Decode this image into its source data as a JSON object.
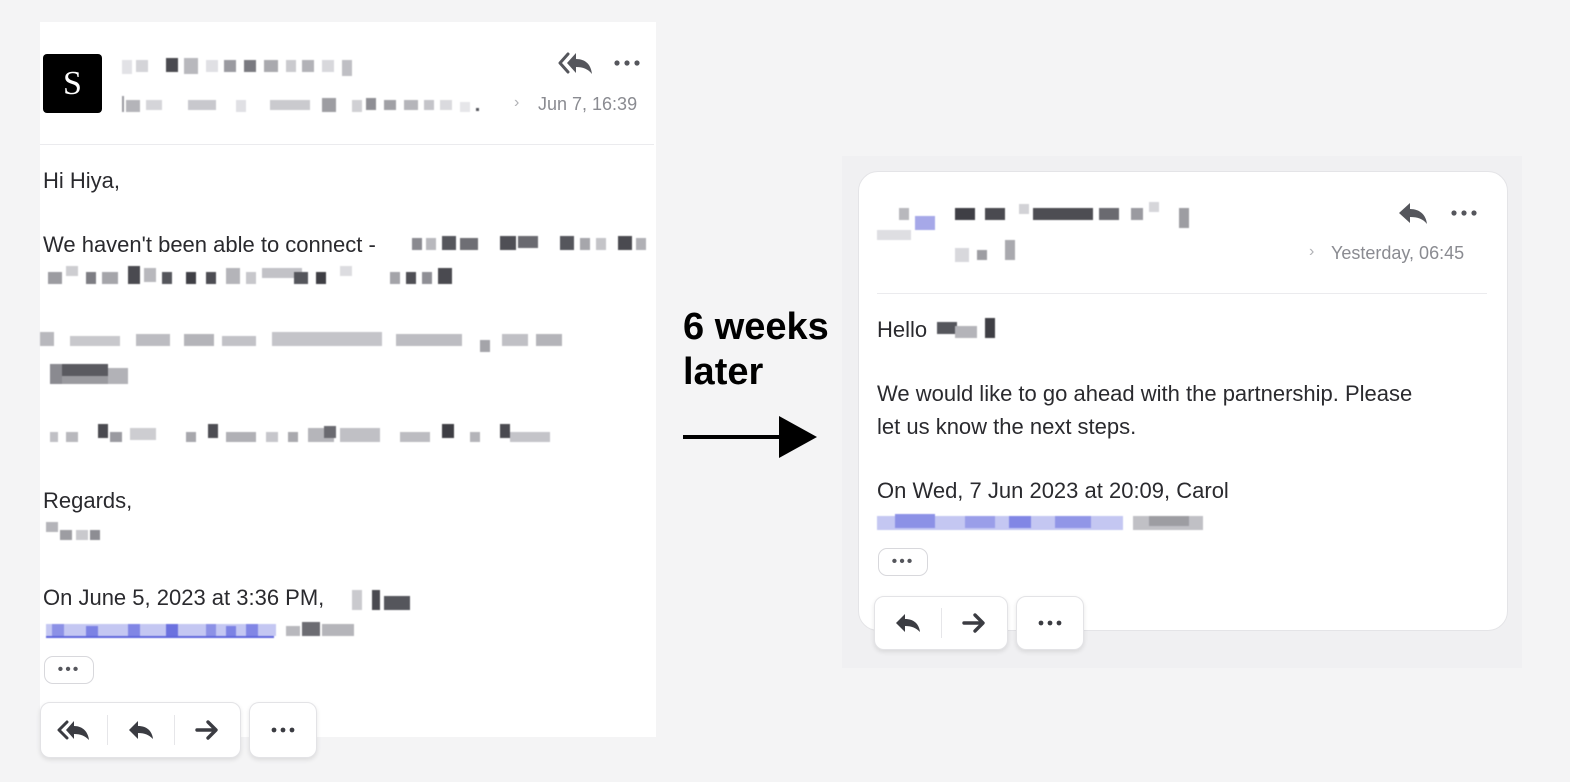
{
  "left_email": {
    "avatar_letter": "S",
    "date": "Jun 7, 16:39",
    "greeting": "Hi Hiya,",
    "para1_prefix": "We haven't been able to connect -",
    "closing": "Regards,",
    "quote_header": "On June 5, 2023 at 3:36 PM,",
    "quote_ellipsis": "•••",
    "icons": {
      "reply_all": "reply-all-icon",
      "more": "more-icon"
    },
    "toolbar": {
      "buttons": [
        "reply-all-icon",
        "reply-icon",
        "forward-icon"
      ],
      "more": "more-icon"
    }
  },
  "caption": {
    "text": "6 weeks\nlater"
  },
  "right_email": {
    "date": "Yesterday, 06:45",
    "greeting": "Hello",
    "body_line1": "We would like to go ahead with the partnership. Please",
    "body_line2": "let us know the next steps.",
    "quote_header": "On Wed, 7 Jun 2023 at 20:09, Carol",
    "quote_ellipsis": "•••",
    "icons": {
      "reply": "reply-icon",
      "more": "more-icon"
    },
    "toolbar": {
      "buttons": [
        "reply-icon",
        "forward-icon"
      ],
      "more": "more-icon"
    }
  },
  "colors": {
    "page_bg": "#f4f4f5",
    "card_bg": "#ffffff",
    "text": "#2a2a2e",
    "muted": "#8a8b91",
    "redaction_dark": "#3a3a40",
    "redaction_link": "#6d72e0"
  }
}
